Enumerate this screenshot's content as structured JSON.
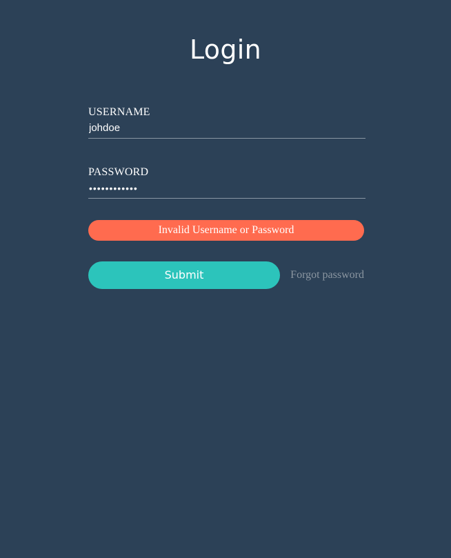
{
  "page": {
    "title": "Login"
  },
  "form": {
    "username": {
      "label": "USERNAME",
      "value": "johdoe"
    },
    "password": {
      "label": "PASSWORD",
      "value": "••••••••••••"
    },
    "error_message": "Invalid Username or Password",
    "submit_label": "Submit",
    "forgot_label": "Forgot password"
  },
  "colors": {
    "background": "#2c4157",
    "error": "#ff6b4f",
    "accent": "#2cc4bb",
    "muted_link": "#8b96a1"
  }
}
